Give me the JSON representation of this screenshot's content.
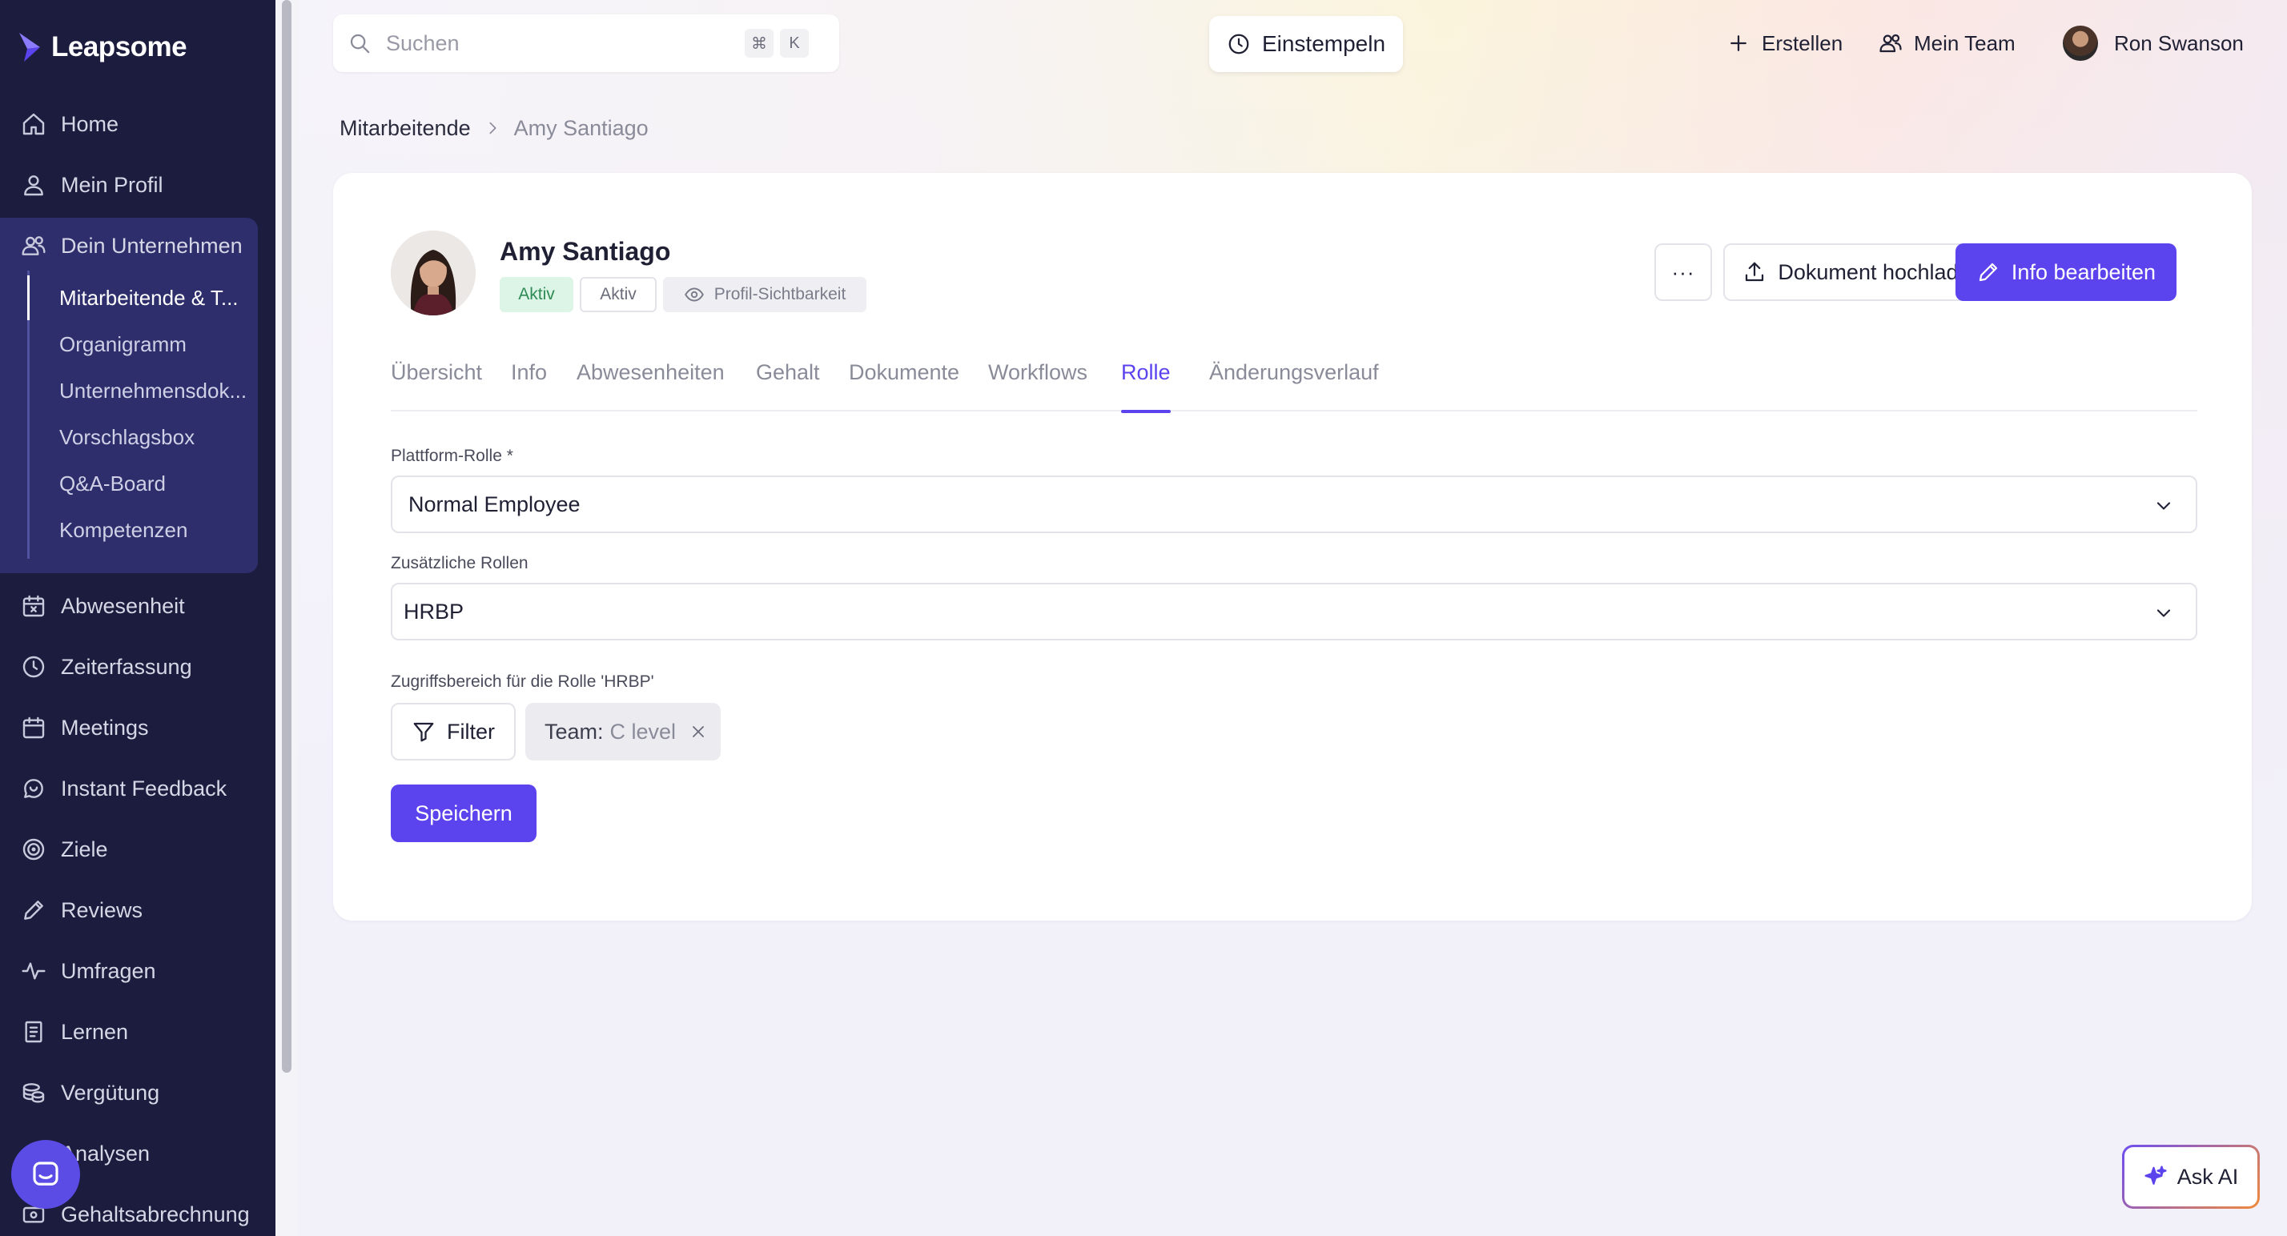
{
  "app": {
    "brand": "Leapsome"
  },
  "sidebar": {
    "items": [
      {
        "label": "Home",
        "icon": "home-icon"
      },
      {
        "label": "Mein Profil",
        "icon": "user-icon"
      },
      {
        "label": "Dein Unternehmen",
        "icon": "users-icon"
      },
      {
        "label": "Abwesenheit",
        "icon": "calendar-x-icon"
      },
      {
        "label": "Zeiterfassung",
        "icon": "clock-icon"
      },
      {
        "label": "Meetings",
        "icon": "calendar-icon"
      },
      {
        "label": "Instant Feedback",
        "icon": "chat-icon"
      },
      {
        "label": "Ziele",
        "icon": "target-icon"
      },
      {
        "label": "Reviews",
        "icon": "pencil-icon"
      },
      {
        "label": "Umfragen",
        "icon": "pulse-icon"
      },
      {
        "label": "Lernen",
        "icon": "book-icon"
      },
      {
        "label": "Vergütung",
        "icon": "coins-icon"
      },
      {
        "label": "Analysen",
        "icon": "chart-icon"
      },
      {
        "label": "Gehaltsabrechnung",
        "icon": "payroll-icon"
      }
    ],
    "sub_items": [
      {
        "label": "Mitarbeitende & T..."
      },
      {
        "label": "Organigramm"
      },
      {
        "label": "Unternehmensdok..."
      },
      {
        "label": "Vorschlagsbox"
      },
      {
        "label": "Q&A-Board"
      },
      {
        "label": "Kompetenzen"
      }
    ]
  },
  "topbar": {
    "search_placeholder": "Suchen",
    "shortcut_mod": "⌘",
    "shortcut_key": "K",
    "clock_in_label": "Einstempeln",
    "create_label": "Erstellen",
    "team_label": "Mein Team",
    "user_name": "Ron Swanson"
  },
  "breadcrumb": {
    "parent": "Mitarbeitende",
    "current": "Amy Santiago"
  },
  "profile": {
    "name": "Amy Santiago",
    "badge_status": "Aktiv",
    "badge_status_outline": "Aktiv",
    "visibility_label": "Profil-Sichtbarkeit",
    "more_label": "···",
    "upload_label": "Dokument hochladen",
    "edit_label": "Info bearbeiten"
  },
  "tabs": [
    {
      "label": "Übersicht"
    },
    {
      "label": "Info"
    },
    {
      "label": "Abwesenheiten"
    },
    {
      "label": "Gehalt"
    },
    {
      "label": "Dokumente"
    },
    {
      "label": "Workflows"
    },
    {
      "label": "Rolle"
    },
    {
      "label": "Änderungsverlauf"
    }
  ],
  "form": {
    "platform_role_label": "Plattform-Rolle *",
    "platform_role_value": "Normal Employee",
    "additional_roles_label": "Zusätzliche Rollen",
    "additional_roles_value": "HRBP",
    "scope_label": "Zugriffsbereich für die Rolle 'HRBP'",
    "filter_label": "Filter",
    "chip_key": "Team:",
    "chip_value": "C level",
    "save_label": "Speichern"
  },
  "ask_ai_label": "Ask AI",
  "colors": {
    "accent": "#5b44ee",
    "sidebar_bg": "#1c1d3e",
    "active_badge_bg": "#dcf5e6"
  }
}
